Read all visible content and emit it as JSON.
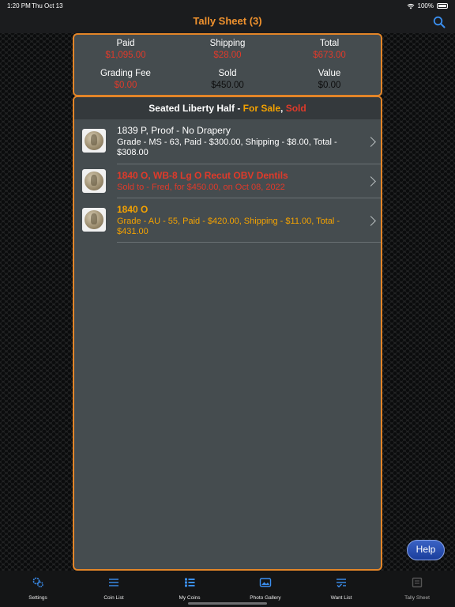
{
  "status": {
    "time": "1:20 PM",
    "date": "Thu Oct 13",
    "battery": "100%"
  },
  "nav": {
    "title": "Tally Sheet (3)",
    "search_icon": "search-icon",
    "accent": "#f0922e"
  },
  "summary": {
    "paid": {
      "label": "Paid",
      "value": "$1,095.00"
    },
    "shipping": {
      "label": "Shipping",
      "value": "$28.00"
    },
    "total": {
      "label": "Total",
      "value": "$673.00"
    },
    "grading_fee": {
      "label": "Grading Fee",
      "value": "$0.00"
    },
    "sold": {
      "label": "Sold",
      "value": "$450.00"
    },
    "value": {
      "label": "Value",
      "value": "$0.00"
    }
  },
  "list": {
    "header": {
      "title": "Seated Liberty Half - ",
      "for_sale": "For Sale",
      "comma": ", ",
      "sold": "Sold"
    },
    "rows": [
      {
        "title": "1839 P, Proof - No Drapery",
        "subtitle": "Grade - MS - 63, Paid - $300.00, Shipping - $8.00, Total - $308.00"
      },
      {
        "title": "1840 O, WB-8 Lg O Recut OBV Dentils",
        "subtitle": "Sold to - Fred, for $450.00, on Oct 08, 2022"
      },
      {
        "title": "1840 O",
        "subtitle": "Grade - AU - 55, Paid - $420.00, Shipping - $11.00, Total - $431.00"
      }
    ]
  },
  "help_label": "Help",
  "tabs": [
    {
      "label": "Settings",
      "icon": "gears-icon"
    },
    {
      "label": "Coin List",
      "icon": "list-lines-icon"
    },
    {
      "label": "My Coins",
      "icon": "bulleted-list-icon"
    },
    {
      "label": "Photo Gallery",
      "icon": "photos-icon"
    },
    {
      "label": "Want List",
      "icon": "checklist-icon"
    },
    {
      "label": "Tally Sheet",
      "icon": "tally-sheet-icon"
    }
  ]
}
